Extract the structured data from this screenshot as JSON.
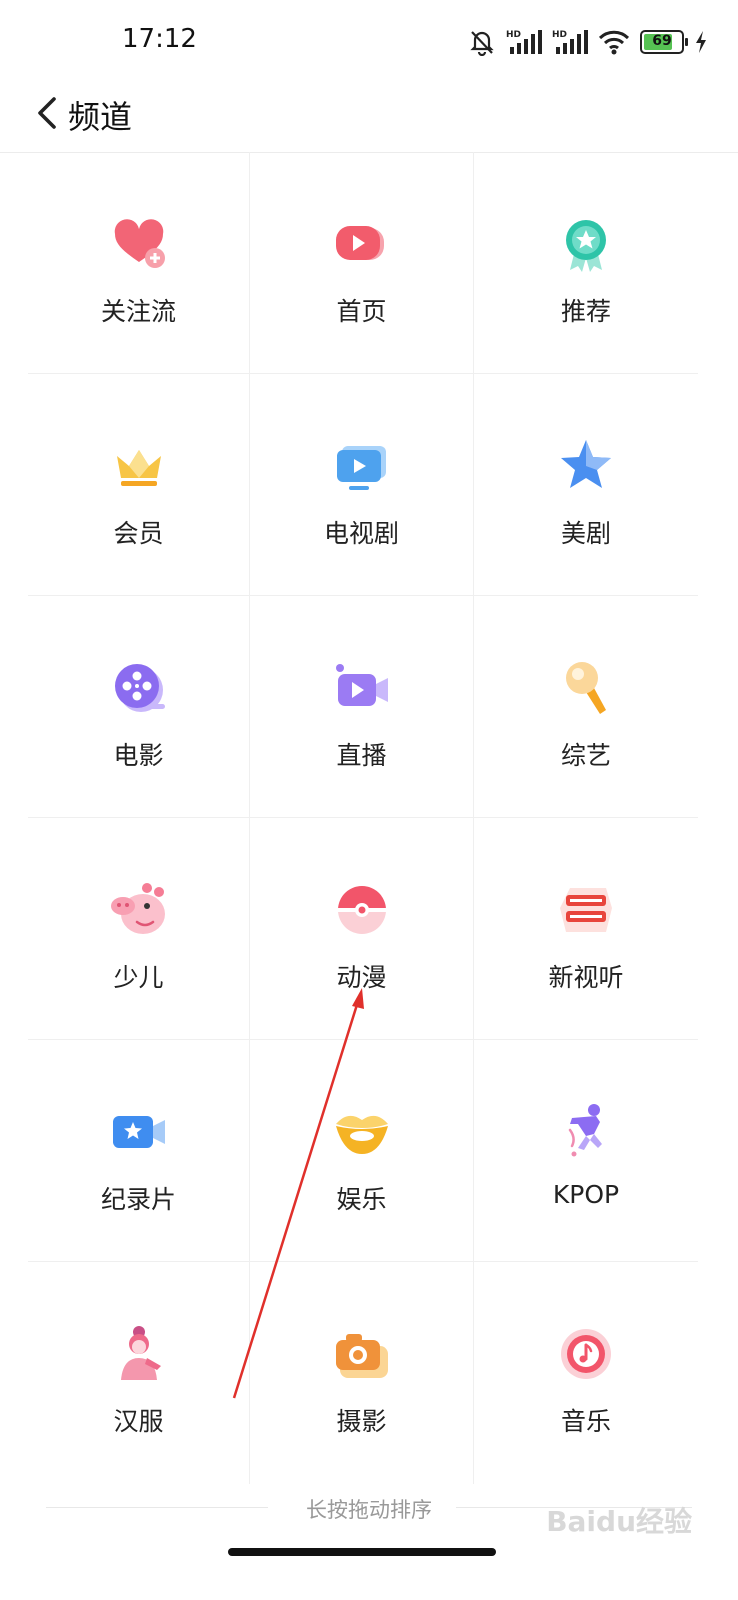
{
  "status_bar": {
    "time": "17:12",
    "battery": "69",
    "icons": [
      "mute-bell-icon",
      "hd-signal-icon",
      "hd-signal-icon",
      "wifi-icon",
      "battery-icon",
      "charging-icon"
    ]
  },
  "header": {
    "title": "频道",
    "back_icon": "chevron-left-icon"
  },
  "channels": [
    {
      "label": "关注流",
      "icon": "heart-plus-icon",
      "color": "#f05a6e"
    },
    {
      "label": "首页",
      "icon": "play-icon",
      "color": "#f25c6c"
    },
    {
      "label": "推荐",
      "icon": "star-medal-icon",
      "color": "#2ec4a8"
    },
    {
      "label": "会员",
      "icon": "crown-icon",
      "color": "#f5b324"
    },
    {
      "label": "电视剧",
      "icon": "tv-icon",
      "color": "#4ea2ee"
    },
    {
      "label": "美剧",
      "icon": "star-icon",
      "color": "#4a8ff0"
    },
    {
      "label": "电影",
      "icon": "film-reel-icon",
      "color": "#8b6cf0"
    },
    {
      "label": "直播",
      "icon": "video-camera-icon",
      "color": "#9b7bf3"
    },
    {
      "label": "综艺",
      "icon": "microphone-icon",
      "color": "#f7b13c"
    },
    {
      "label": "少儿",
      "icon": "pig-icon",
      "color": "#f57d95"
    },
    {
      "label": "动漫",
      "icon": "pokeball-icon",
      "color": "#f2556a"
    },
    {
      "label": "新视听",
      "icon": "new-media-logo-icon",
      "color": "#e8453c"
    },
    {
      "label": "纪录片",
      "icon": "camera-star-icon",
      "color": "#3f8df0"
    },
    {
      "label": "娱乐",
      "icon": "lips-icon",
      "color": "#f5b324"
    },
    {
      "label": "KPOP",
      "icon": "dancer-icon",
      "color": "#8c6cf2"
    },
    {
      "label": "汉服",
      "icon": "hanfu-girl-icon",
      "color": "#ee6a8a"
    },
    {
      "label": "摄影",
      "icon": "camera-icon",
      "color": "#f0923a"
    },
    {
      "label": "音乐",
      "icon": "music-disc-icon",
      "color": "#f2556a"
    }
  ],
  "footer": {
    "hint": "长按拖动排序"
  },
  "watermark": "Baidu经验"
}
